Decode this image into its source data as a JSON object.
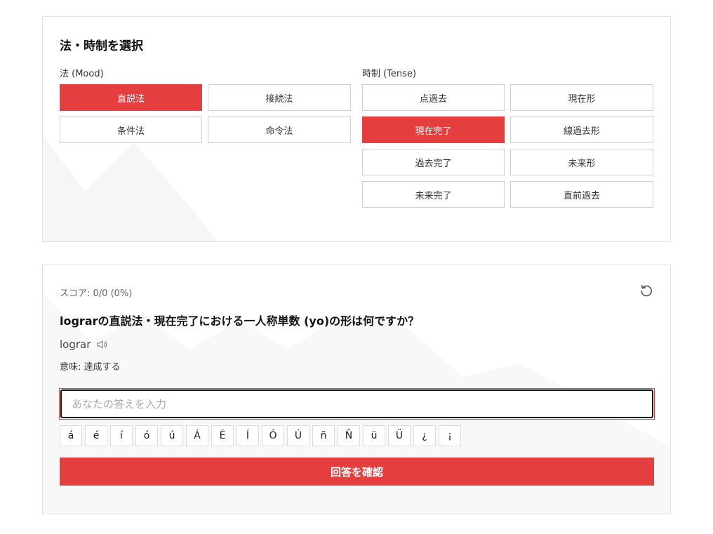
{
  "selection": {
    "title": "法・時制を選択",
    "mood_label": "法 (Mood)",
    "tense_label": "時制 (Tense)",
    "moods": [
      {
        "label": "直説法",
        "active": true
      },
      {
        "label": "接続法",
        "active": false
      },
      {
        "label": "条件法",
        "active": false
      },
      {
        "label": "命令法",
        "active": false
      }
    ],
    "tenses": [
      {
        "label": "点過去",
        "active": false
      },
      {
        "label": "現在形",
        "active": false
      },
      {
        "label": "現在完了",
        "active": true
      },
      {
        "label": "線過去形",
        "active": false
      },
      {
        "label": "過去完了",
        "active": false
      },
      {
        "label": "未来形",
        "active": false
      },
      {
        "label": "未来完了",
        "active": false
      },
      {
        "label": "直前過去",
        "active": false
      }
    ]
  },
  "quiz": {
    "score": "スコア: 0/0 (0%)",
    "reset_icon": "refresh-icon",
    "question": "lograrの直説法・現在完了における一人称単数 (yo)の形は何ですか？",
    "word": "lograr",
    "speaker_icon": "speaker-icon",
    "meaning": "意味: 達成する",
    "answer_value": "",
    "answer_placeholder": "あなたの答えを入力",
    "special_chars": [
      "á",
      "é",
      "í",
      "ó",
      "ú",
      "Á",
      "É",
      "Í",
      "Ó",
      "Ú",
      "ñ",
      "Ñ",
      "ü",
      "Ü",
      "¿",
      "¡"
    ],
    "submit_label": "回答を確認"
  },
  "colors": {
    "accent": "#e53e3e",
    "border": "#e3e3e3"
  }
}
